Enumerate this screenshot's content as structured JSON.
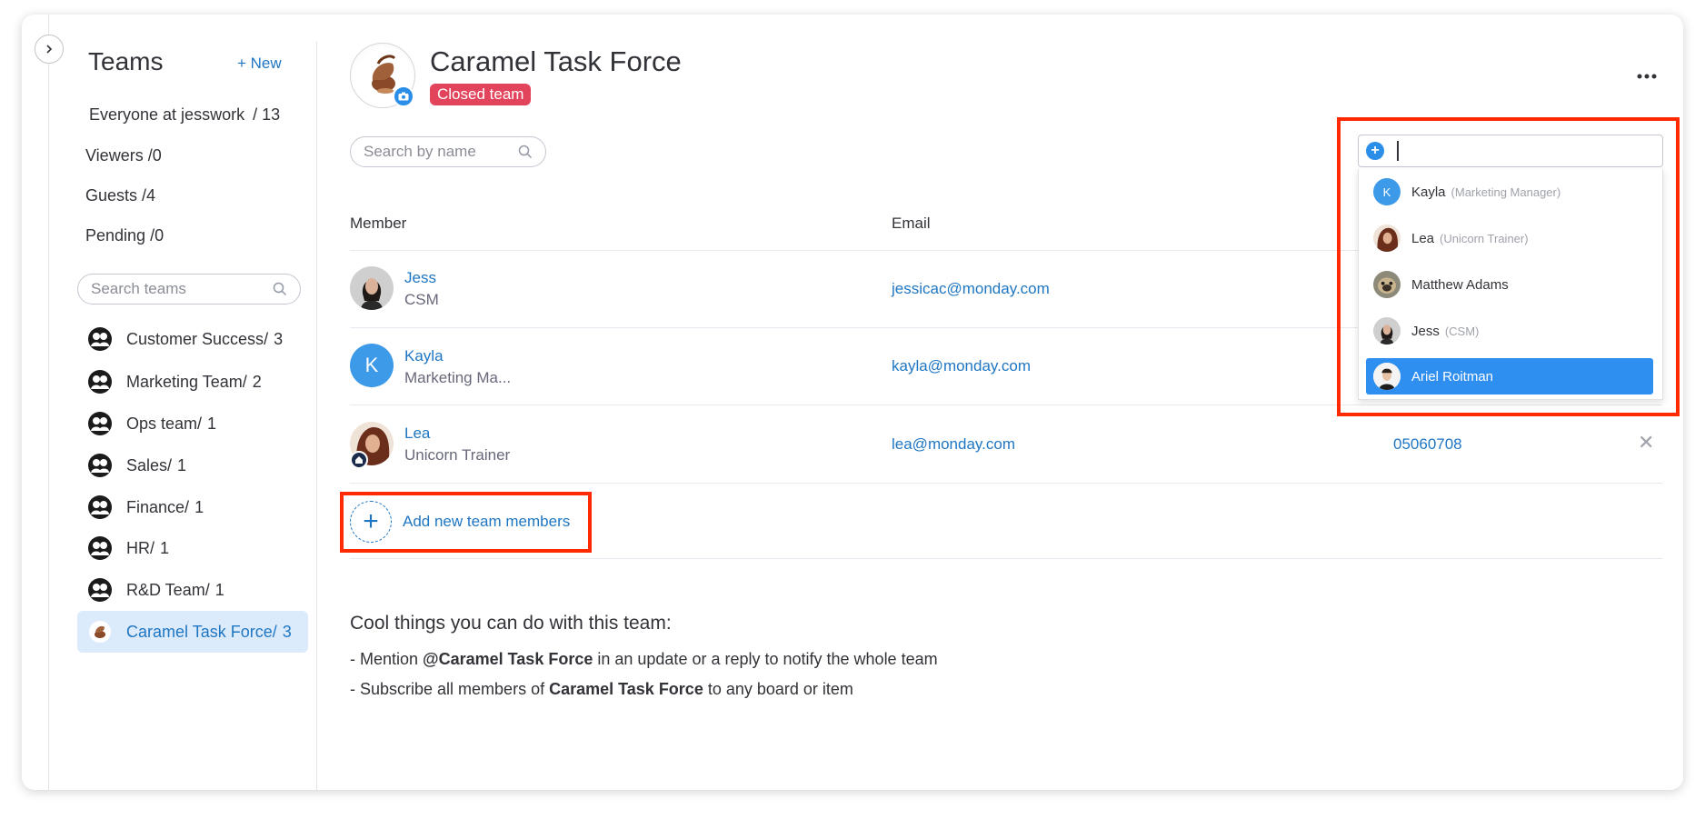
{
  "sidebar": {
    "title": "Teams",
    "new_label": "+ New",
    "groups": [
      {
        "label": "Everyone at jesswork",
        "count": "13"
      },
      {
        "label": "Viewers",
        "count": "0"
      },
      {
        "label": "Guests",
        "count": "4"
      },
      {
        "label": "Pending",
        "count": "0"
      }
    ],
    "search_placeholder": "Search teams",
    "teams": [
      {
        "name": "Customer Success",
        "count": "3"
      },
      {
        "name": "Marketing Team",
        "count": "2"
      },
      {
        "name": "Ops team",
        "count": "1"
      },
      {
        "name": "Sales",
        "count": "1"
      },
      {
        "name": "Finance",
        "count": "1"
      },
      {
        "name": "HR",
        "count": "1"
      },
      {
        "name": "R&D Team",
        "count": "1"
      },
      {
        "name": "Caramel Task Force",
        "count": "3"
      }
    ]
  },
  "team": {
    "title": "Caramel Task Force",
    "badge": "Closed team",
    "search_placeholder": "Search by name"
  },
  "table": {
    "col_member": "Member",
    "col_email": "Email",
    "members": [
      {
        "name": "Jess",
        "role": "CSM",
        "email": "jessicac@monday.com",
        "phone": "",
        "initial": ""
      },
      {
        "name": "Kayla",
        "role": "Marketing Ma...",
        "email": "kayla@monday.com",
        "phone": "",
        "initial": "K"
      },
      {
        "name": "Lea",
        "role": "Unicorn Trainer",
        "email": "lea@monday.com",
        "phone": "05060708",
        "initial": ""
      }
    ],
    "remove_glyph": "✕"
  },
  "add_members": {
    "plus": "+",
    "label": "Add new team members"
  },
  "cool": {
    "title": "Cool things you can do with this team:",
    "line1_prefix": "- Mention ",
    "line1_bold": "@Caramel Task Force",
    "line1_suffix": " in an update or a reply to notify the whole team",
    "line2_prefix": "- Subscribe all members of ",
    "line2_bold": "Caramel Task Force",
    "line2_suffix": " to any board or item"
  },
  "dropdown": {
    "plus": "+",
    "options": [
      {
        "name": "Kayla",
        "role": "(Marketing Manager)",
        "initial": "K"
      },
      {
        "name": "Lea",
        "role": "(Unicorn Trainer)",
        "initial": ""
      },
      {
        "name": "Matthew Adams",
        "role": "",
        "initial": ""
      },
      {
        "name": "Jess",
        "role": "(CSM)",
        "initial": ""
      },
      {
        "name": "Ariel Roitman",
        "role": "",
        "initial": ""
      }
    ]
  },
  "colors": {
    "accent": "#1f76c2",
    "badge_red": "#e2445c",
    "highlight": "#ff2a00",
    "selected": "#2e8ff0"
  }
}
